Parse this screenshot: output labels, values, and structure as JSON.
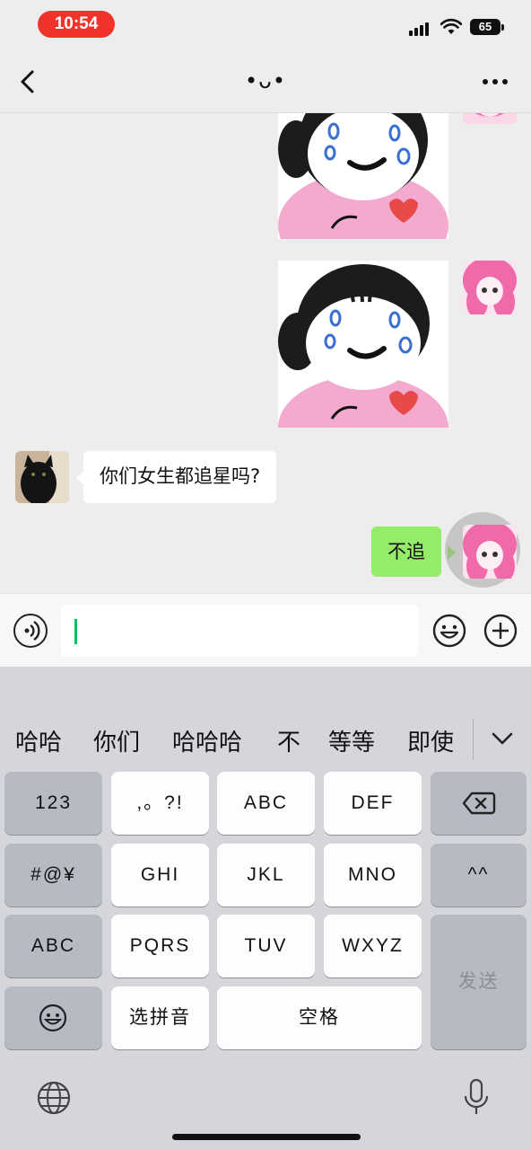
{
  "status_bar": {
    "time": "10:54",
    "battery": "65",
    "time_pill_color": "#f0342c",
    "icons": [
      "signal-icon",
      "wifi-icon",
      "battery-icon"
    ]
  },
  "nav": {
    "title": "•ᴗ•",
    "icons": [
      "back-chevron-icon",
      "more-icon"
    ]
  },
  "chat": {
    "messages": [
      {
        "sender": "me",
        "type": "sticker",
        "description_icon": "crying-girl-sticker"
      },
      {
        "sender": "me",
        "type": "sticker",
        "description_icon": "crying-girl-sticker"
      },
      {
        "sender": "other",
        "type": "text",
        "text": "你们女生都追星吗?"
      },
      {
        "sender": "me",
        "type": "text",
        "text": "不追"
      }
    ],
    "bubble_colors": {
      "mine": "#95ec69",
      "theirs": "#ffffff"
    }
  },
  "input_bar": {
    "value": "",
    "icons": [
      "voice-icon",
      "emoji-icon",
      "plus-icon"
    ],
    "caret_color": "#07c160"
  },
  "keyboard": {
    "candidates": [
      "哈哈",
      "你们",
      "哈哈哈",
      "不",
      "等等",
      "即使"
    ],
    "keys": {
      "num": "123",
      "punct": ",。?!",
      "abc": "ABC",
      "def": "DEF",
      "symbols": "#@¥",
      "ghi": "GHI",
      "jkl": "JKL",
      "mno": "MNO",
      "emoticon": "^^",
      "abc_mode": "ABC",
      "pqrs": "PQRS",
      "tuv": "TUV",
      "wxyz": "WXYZ",
      "send": "发送",
      "pinyin": "选拼音",
      "space": "空格"
    },
    "icons": [
      "backspace-icon",
      "emoji-icon",
      "globe-icon",
      "microphone-icon",
      "chevron-down-icon"
    ]
  }
}
